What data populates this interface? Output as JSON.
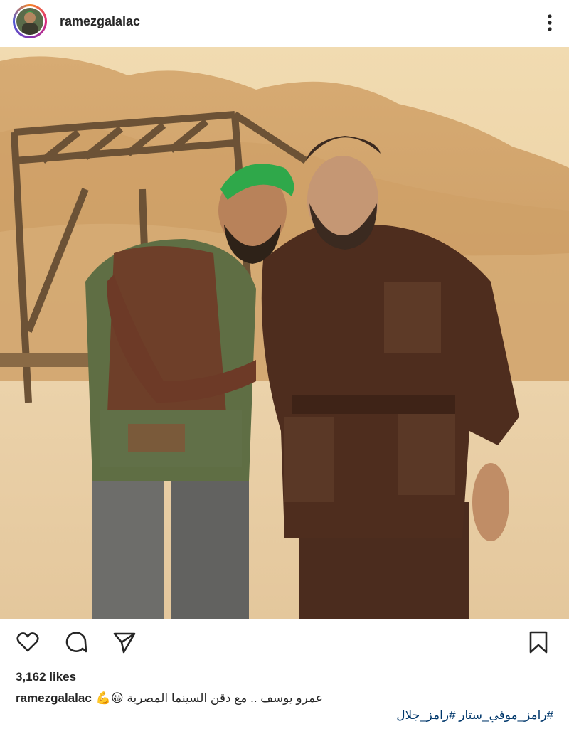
{
  "post": {
    "username": "ramezgalalac",
    "likes": "3,162 likes",
    "caption": {
      "username": "ramezgalalac",
      "text": "عمرو يوسف .. مع دقن السينما المصرية 😀💪",
      "hashtags": "#رامز_موفي_ستار #رامز_جلال"
    }
  },
  "icons": {
    "more": "more-vertical-icon",
    "like": "heart-icon",
    "comment": "comment-bubble-icon",
    "share": "paper-plane-icon",
    "save": "bookmark-icon"
  },
  "colors": {
    "sky": "#ecd3a3",
    "sand": "#e8c89b",
    "cliff": "#d2a36b",
    "bridge": "#6c5236",
    "text": "#262626",
    "hashtag": "#00376b"
  }
}
